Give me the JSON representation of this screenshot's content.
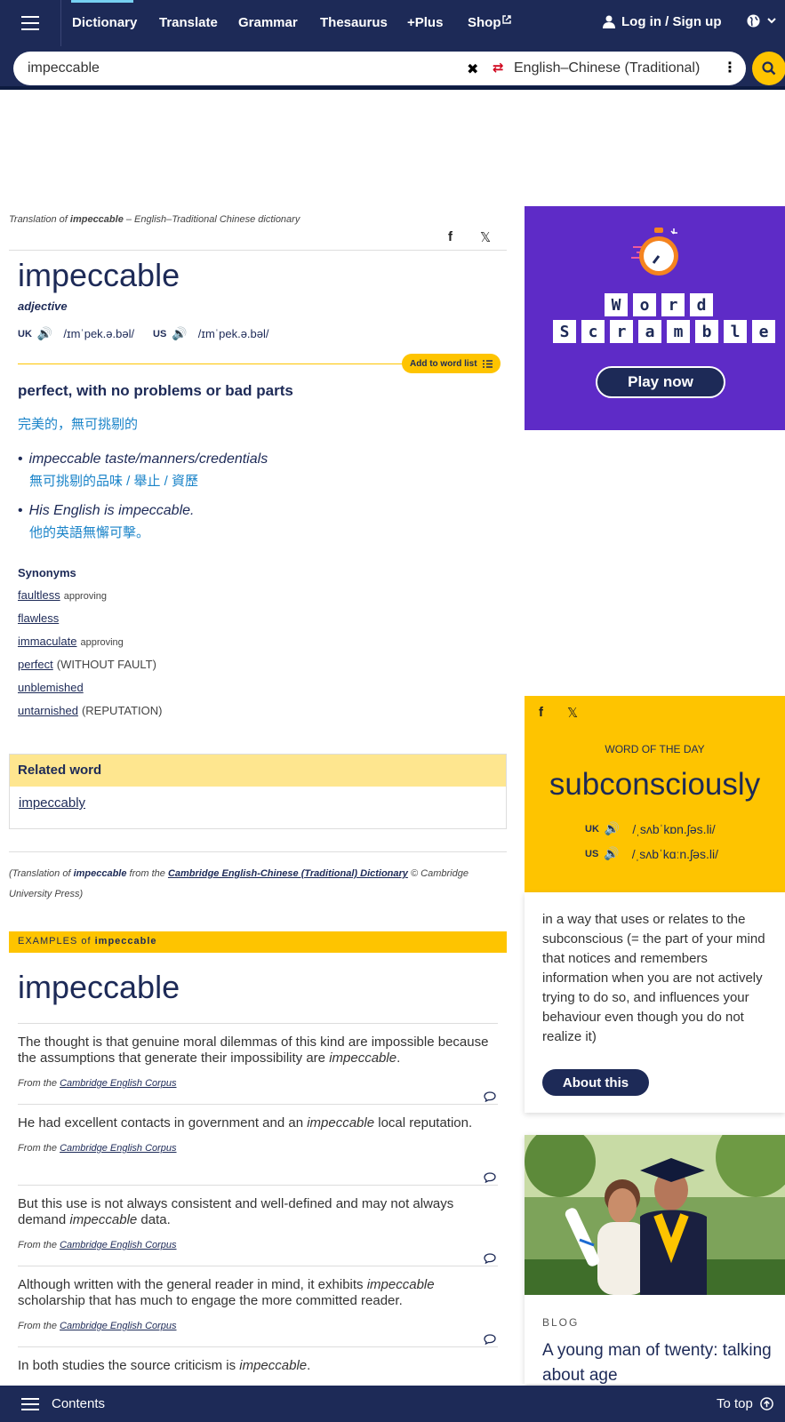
{
  "nav": {
    "items": [
      "Dictionary",
      "Translate",
      "Grammar",
      "Thesaurus",
      "+Plus",
      "Shop"
    ],
    "login": "Log in / Sign up"
  },
  "search": {
    "value": "impeccable",
    "language": "English–Chinese (Traditional)"
  },
  "entry": {
    "attribution_prefix": "Translation of",
    "attribution_word": "impeccable",
    "attribution_suffix": "– English–Traditional Chinese dictionary",
    "headword": "impeccable",
    "pos": "adjective",
    "uk_label": "UK",
    "uk_ipa": "/ɪmˈpek.ə.bəl/",
    "us_label": "US",
    "us_ipa": "/ɪmˈpek.ə.bəl/",
    "add_to_word_list": "Add to word list",
    "definition": "perfect, with no problems or bad parts",
    "translation": "完美的，無可挑剔的",
    "examples": [
      {
        "en": "impeccable taste/manners/credentials",
        "zh": "無可挑剔的品味 / 舉止 / 資歷"
      },
      {
        "en": "His English is impeccable.",
        "zh": "他的英語無懈可擊。"
      }
    ],
    "synonyms_title": "Synonyms",
    "synonyms": [
      {
        "word": "faultless",
        "note": "approving",
        "paren": ""
      },
      {
        "word": "flawless",
        "note": "",
        "paren": ""
      },
      {
        "word": "immaculate",
        "note": "approving",
        "paren": ""
      },
      {
        "word": "perfect",
        "note": "",
        "paren": "(WITHOUT FAULT)"
      },
      {
        "word": "unblemished",
        "note": "",
        "paren": ""
      },
      {
        "word": "untarnished",
        "note": "",
        "paren": "(REPUTATION)"
      }
    ],
    "related_title": "Related word",
    "related_word": "impeccably",
    "credit_1": "(Translation of",
    "credit_word": "impeccable",
    "credit_2": "from the",
    "credit_link": "Cambridge English-Chinese (Traditional) Dictionary",
    "credit_3": "© Cambridge University Press)"
  },
  "examples_section": {
    "bar_label": "EXAMPLES of",
    "bar_word": "impeccable",
    "heading": "impeccable",
    "source_prefix": "From the",
    "source_link": "Cambridge English Corpus",
    "sentences": [
      {
        "before": "The thought is that genuine moral dilemmas of this kind are impossible because the assumptions that generate their impossibility are ",
        "em": "impeccable",
        "after": "."
      },
      {
        "before": "He had excellent contacts in government and an ",
        "em": "impeccable",
        "after": " local reputation."
      },
      {
        "before": "But this use is not always consistent and well-defined and may not always demand ",
        "em": "impeccable",
        "after": " data."
      },
      {
        "before": "Although written with the general reader in mind, it exhibits ",
        "em": "impeccable",
        "after": " scholarship that has much to engage the more committed reader."
      },
      {
        "before": "In both studies the source criticism is ",
        "em": "impeccable",
        "after": "."
      }
    ]
  },
  "ad": {
    "line1": [
      "W",
      "o",
      "r",
      "d"
    ],
    "line2": [
      "S",
      "c",
      "r",
      "a",
      "m",
      "b",
      "l",
      "e"
    ],
    "play": "Play now"
  },
  "wotd": {
    "label": "WORD OF THE DAY",
    "word": "subconsciously",
    "uk_label": "UK",
    "uk_ipa": "/ˌsʌbˈkɒn.ʃəs.li/",
    "us_label": "US",
    "us_ipa": "/ˌsʌbˈkɑːn.ʃəs.li/",
    "definition": "in a way that uses or relates to the subconscious (= the part of your mind that notices and remembers information when you are not actively trying to do so, and influences your behaviour even though you do not realize it)",
    "about": "About this"
  },
  "blog": {
    "label": "BLOG",
    "title": "A young man of twenty: talking about age"
  },
  "footer": {
    "contents": "Contents",
    "to_top": "To top"
  },
  "colors": {
    "navy": "#1d2a57",
    "yellow": "#fec400",
    "purple": "#5e2bc7",
    "chinese_blue": "#1b84c9"
  }
}
